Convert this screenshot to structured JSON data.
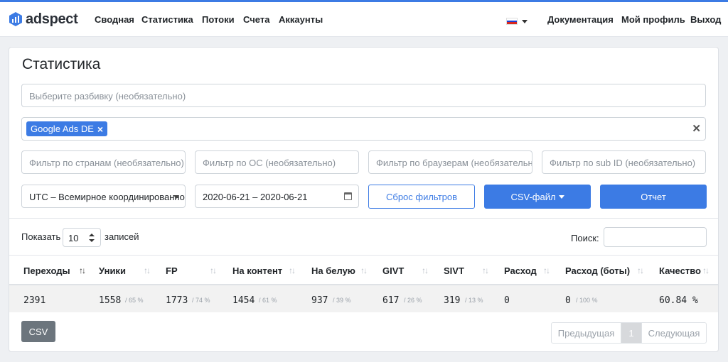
{
  "nav": {
    "brand": "adspect",
    "links": [
      "Сводная",
      "Статистика",
      "Потоки",
      "Счета",
      "Аккаунты"
    ],
    "right_links": [
      "Документация",
      "Мой профиль",
      "Выход"
    ],
    "flag": "russia-flag-icon",
    "colors": {
      "accent": "#3c7be4"
    }
  },
  "page": {
    "title": "Статистика",
    "breakdown_placeholder": "Выберите разбивку (необязательно)",
    "stream_tag": "Google Ads DE",
    "filters": {
      "countries": "Фильтр по странам (необязательно)",
      "os": "Фильтр по ОС (необязательно)",
      "browsers": "Фильтр по браузерам (необязательно)",
      "subid": "Фильтр по sub ID (необязательно)"
    },
    "timezone": "UTC – Всемирное координированное время",
    "date_range": "2020-06-21 – 2020-06-21",
    "buttons": {
      "reset": "Сброс фильтров",
      "csv_file": "CSV-файл",
      "report": "Отчет",
      "csv": "CSV"
    }
  },
  "table_controls": {
    "show_label": "Показать",
    "page_length": "10",
    "records_label": "записей",
    "search_label": "Поиск:"
  },
  "table": {
    "columns": [
      "Переходы",
      "Уники",
      "FP",
      "На контент",
      "На белую",
      "GIVT",
      "SIVT",
      "Расход",
      "Расход (боты)",
      "Качество"
    ],
    "row": [
      {
        "value": "2391",
        "pct": ""
      },
      {
        "value": "1558",
        "pct": "/ 65 %"
      },
      {
        "value": "1773",
        "pct": "/ 74 %"
      },
      {
        "value": "1454",
        "pct": "/ 61 %"
      },
      {
        "value": "937",
        "pct": "/ 39 %"
      },
      {
        "value": "617",
        "pct": "/ 26 %"
      },
      {
        "value": "319",
        "pct": "/ 13 %"
      },
      {
        "value": "0",
        "pct": ""
      },
      {
        "value": "0",
        "pct": "/ 100 %"
      },
      {
        "value": "60.84 %",
        "pct": ""
      }
    ]
  },
  "pagination": {
    "prev": "Предыдущая",
    "current": "1",
    "next": "Следующая"
  }
}
